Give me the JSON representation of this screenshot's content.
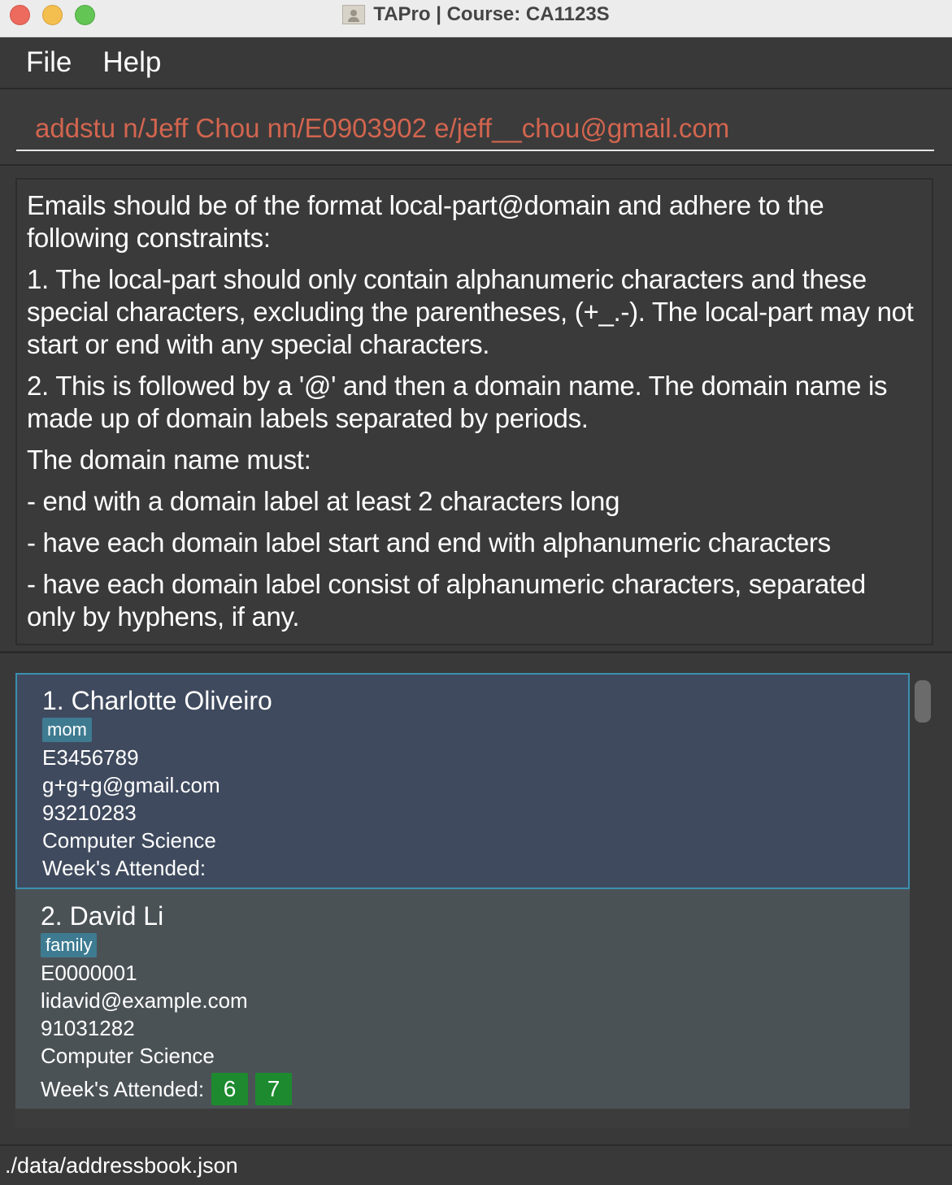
{
  "window": {
    "title": "TAPro | Course: CA1123S"
  },
  "menu": {
    "file_label": "File",
    "help_label": "Help"
  },
  "command_box": {
    "value": "addstu n/Jeff Chou nn/E0903902 e/jeff__chou@gmail.com",
    "text_color": "#d2654f"
  },
  "result_display": {
    "paragraphs": [
      "Emails should be of the format local-part@domain and adhere to the following constraints:",
      "1. The local-part should only contain alphanumeric characters and these special characters, excluding the parentheses, (+_.-). The local-part may not start or end with any special characters.",
      "2. This is followed by a '@' and then a domain name. The domain name is made up of domain labels separated by periods.",
      "The domain name must:",
      "- end with a domain label at least 2 characters long",
      "- have each domain label start and end with alphanumeric characters",
      "- have each domain label consist of alphanumeric characters, separated only by hyphens, if any."
    ]
  },
  "person_list": {
    "selected_index": 1,
    "persons": [
      {
        "name": "1.  Charlotte Oliveiro",
        "tag": "mom",
        "student_number": "E3456789",
        "email": "g+g+g@gmail.com",
        "phone": "93210283",
        "course": "Computer Science",
        "weeks_label": "Week's Attended:",
        "weeks": []
      },
      {
        "name": "2.  David Li",
        "tag": "family",
        "student_number": "E0000001",
        "email": "lidavid@example.com",
        "phone": "91031282",
        "course": "Computer Science",
        "weeks_label": "Week's Attended:",
        "weeks": [
          "6",
          "7"
        ]
      }
    ],
    "colors": {
      "selected_card": "#3f4a5e",
      "selected_border": "#3b8fb0",
      "tag": "#3e7b91",
      "week_badge": "#1d8a2f"
    }
  },
  "status_bar": {
    "path": "./data/addressbook.json"
  }
}
